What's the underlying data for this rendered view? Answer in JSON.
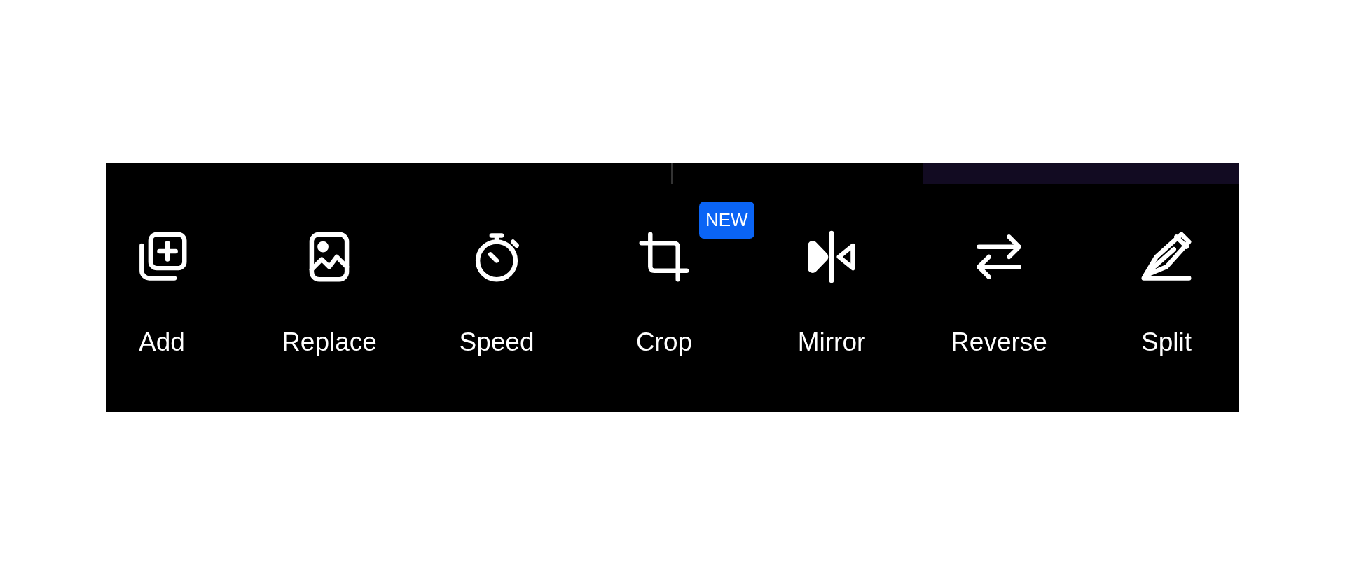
{
  "toolbar": {
    "items": [
      {
        "label": "Add"
      },
      {
        "label": "Replace"
      },
      {
        "label": "Speed"
      },
      {
        "label": "Crop",
        "badge": "NEW"
      },
      {
        "label": "Mirror"
      },
      {
        "label": "Reverse"
      },
      {
        "label": "Split"
      }
    ]
  }
}
